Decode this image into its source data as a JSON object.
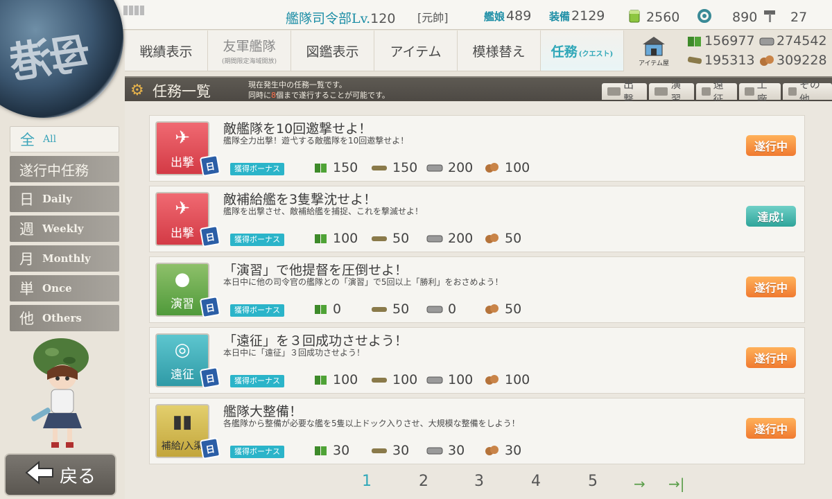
{
  "header": {
    "hq_label": "艦隊司令部",
    "lv_label": "Lv.",
    "level": "120",
    "rank": "[元帥]",
    "ships_label": "艦娘",
    "ships": "489",
    "equip_label": "装備",
    "equip": "2129",
    "buckets": "2560",
    "devmat": "890",
    "screws": "27"
  },
  "logo_text": "母港",
  "nav": {
    "record": "戦績表示",
    "friend_fleet": "友軍艦隊",
    "friend_fleet_sub": "(期間限定海域開放)",
    "library": "図鑑表示",
    "item": "アイテム",
    "remodel": "模様替え",
    "quest": "任務",
    "quest_sub": "(クエスト)",
    "item_shop": "アイテム屋"
  },
  "resources": {
    "fuel": "156977",
    "steel": "274542",
    "ammo": "195313",
    "bauxite": "309228"
  },
  "title": {
    "text": "任務一覧",
    "desc_line1": "現在発生中の任務一覧です。",
    "desc_line2_pre": "同時に",
    "desc_line2_num": "8",
    "desc_line2_post": "個まで遂行することが可能です。"
  },
  "categories": [
    "出撃",
    "演習",
    "遠征",
    "工廠",
    "その他"
  ],
  "filters": {
    "all_big": "全",
    "all_en": "All",
    "in_progress": "遂行中任務",
    "daily_big": "日",
    "daily_en": "Daily",
    "weekly_big": "週",
    "weekly_en": "Weekly",
    "monthly_big": "月",
    "monthly_en": "Monthly",
    "once_big": "単",
    "once_en": "Once",
    "others_big": "他",
    "others_en": "Others"
  },
  "bonus_label": "獲得ボーナス",
  "badge_label": "日",
  "quests": [
    {
      "icon_label": "出撃",
      "title": "敵艦隊を10回邀撃せよ！",
      "desc": "艦隊全力出撃！遊弋する敵艦隊を10回邀撃せよ！",
      "fuel": "150",
      "ammo": "150",
      "steel": "200",
      "bauxite": "100",
      "status": "遂行中"
    },
    {
      "icon_label": "出撃",
      "title": "敵補給艦を3隻撃沈せよ！",
      "desc": "艦隊を出撃させ、敵補給艦を捕捉、これを撃滅せよ！",
      "fuel": "100",
      "ammo": "50",
      "steel": "200",
      "bauxite": "50",
      "status": "達成!"
    },
    {
      "icon_label": "演習",
      "title": "「演習」で他提督を圧倒せよ！",
      "desc": "本日中に他の司令官の艦隊との「演習」で5回以上「勝利」をおさめよう！",
      "fuel": "0",
      "ammo": "50",
      "steel": "0",
      "bauxite": "50",
      "status": "遂行中"
    },
    {
      "icon_label": "遠征",
      "title": "「遠征」を３回成功させよう！",
      "desc": "本日中に「遠征」３回成功させよう！",
      "fuel": "100",
      "ammo": "100",
      "steel": "100",
      "bauxite": "100",
      "status": "遂行中"
    },
    {
      "icon_label": "補給/入渠",
      "title": "艦隊大整備！",
      "desc": "各艦隊から整備が必要な艦を5隻以上ドック入りさせ、大規模な整備をしよう！",
      "fuel": "30",
      "ammo": "30",
      "steel": "30",
      "bauxite": "30",
      "status": "遂行中"
    }
  ],
  "pager": {
    "pages": [
      "1",
      "2",
      "3",
      "4",
      "5"
    ],
    "current": "1",
    "next": "→",
    "last": "→|"
  },
  "back_label": "戻る",
  "colors": {
    "accent": "#2fa7b8",
    "in_progress": "#f07a30",
    "complete": "#2fa49a"
  }
}
